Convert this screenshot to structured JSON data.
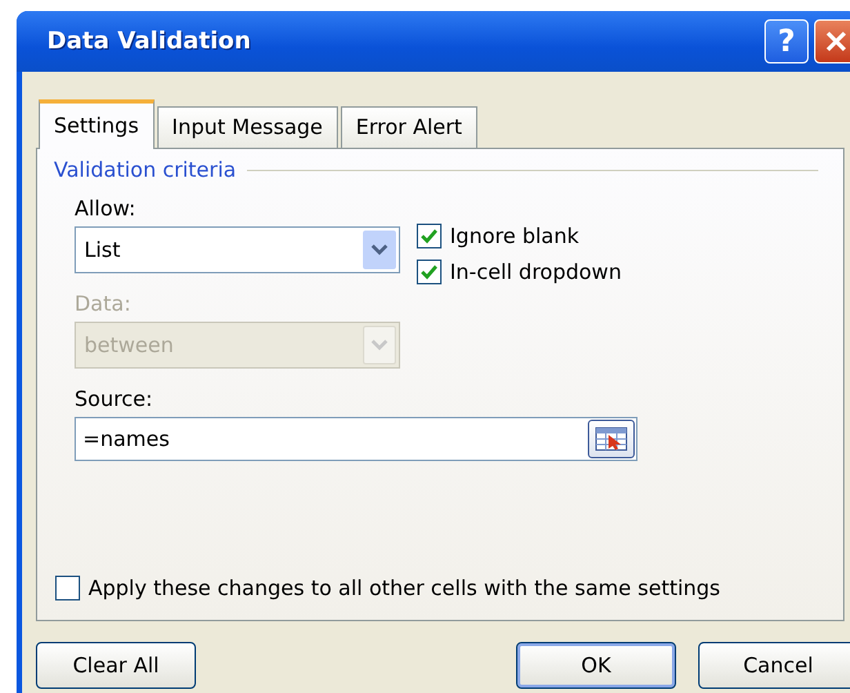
{
  "window": {
    "title": "Data Validation",
    "help": "?"
  },
  "tabs": [
    {
      "label": "Settings",
      "selected": true
    },
    {
      "label": "Input Message",
      "selected": false
    },
    {
      "label": "Error Alert",
      "selected": false
    }
  ],
  "group": {
    "title": "Validation criteria"
  },
  "allow": {
    "label": "Allow:",
    "value": "List",
    "disabled": false
  },
  "options": [
    {
      "label": "Ignore blank",
      "checked": true
    },
    {
      "label": "In-cell dropdown",
      "checked": true
    }
  ],
  "data": {
    "label": "Data:",
    "value": "between",
    "disabled": true
  },
  "source": {
    "label": "Source:",
    "value": "=names"
  },
  "apply_all": {
    "label": "Apply these changes to all other cells with the same settings",
    "checked": false
  },
  "buttons": [
    {
      "label": "Clear All",
      "default": false
    },
    {
      "label": "OK",
      "default": true
    },
    {
      "label": "Cancel",
      "default": false
    }
  ]
}
